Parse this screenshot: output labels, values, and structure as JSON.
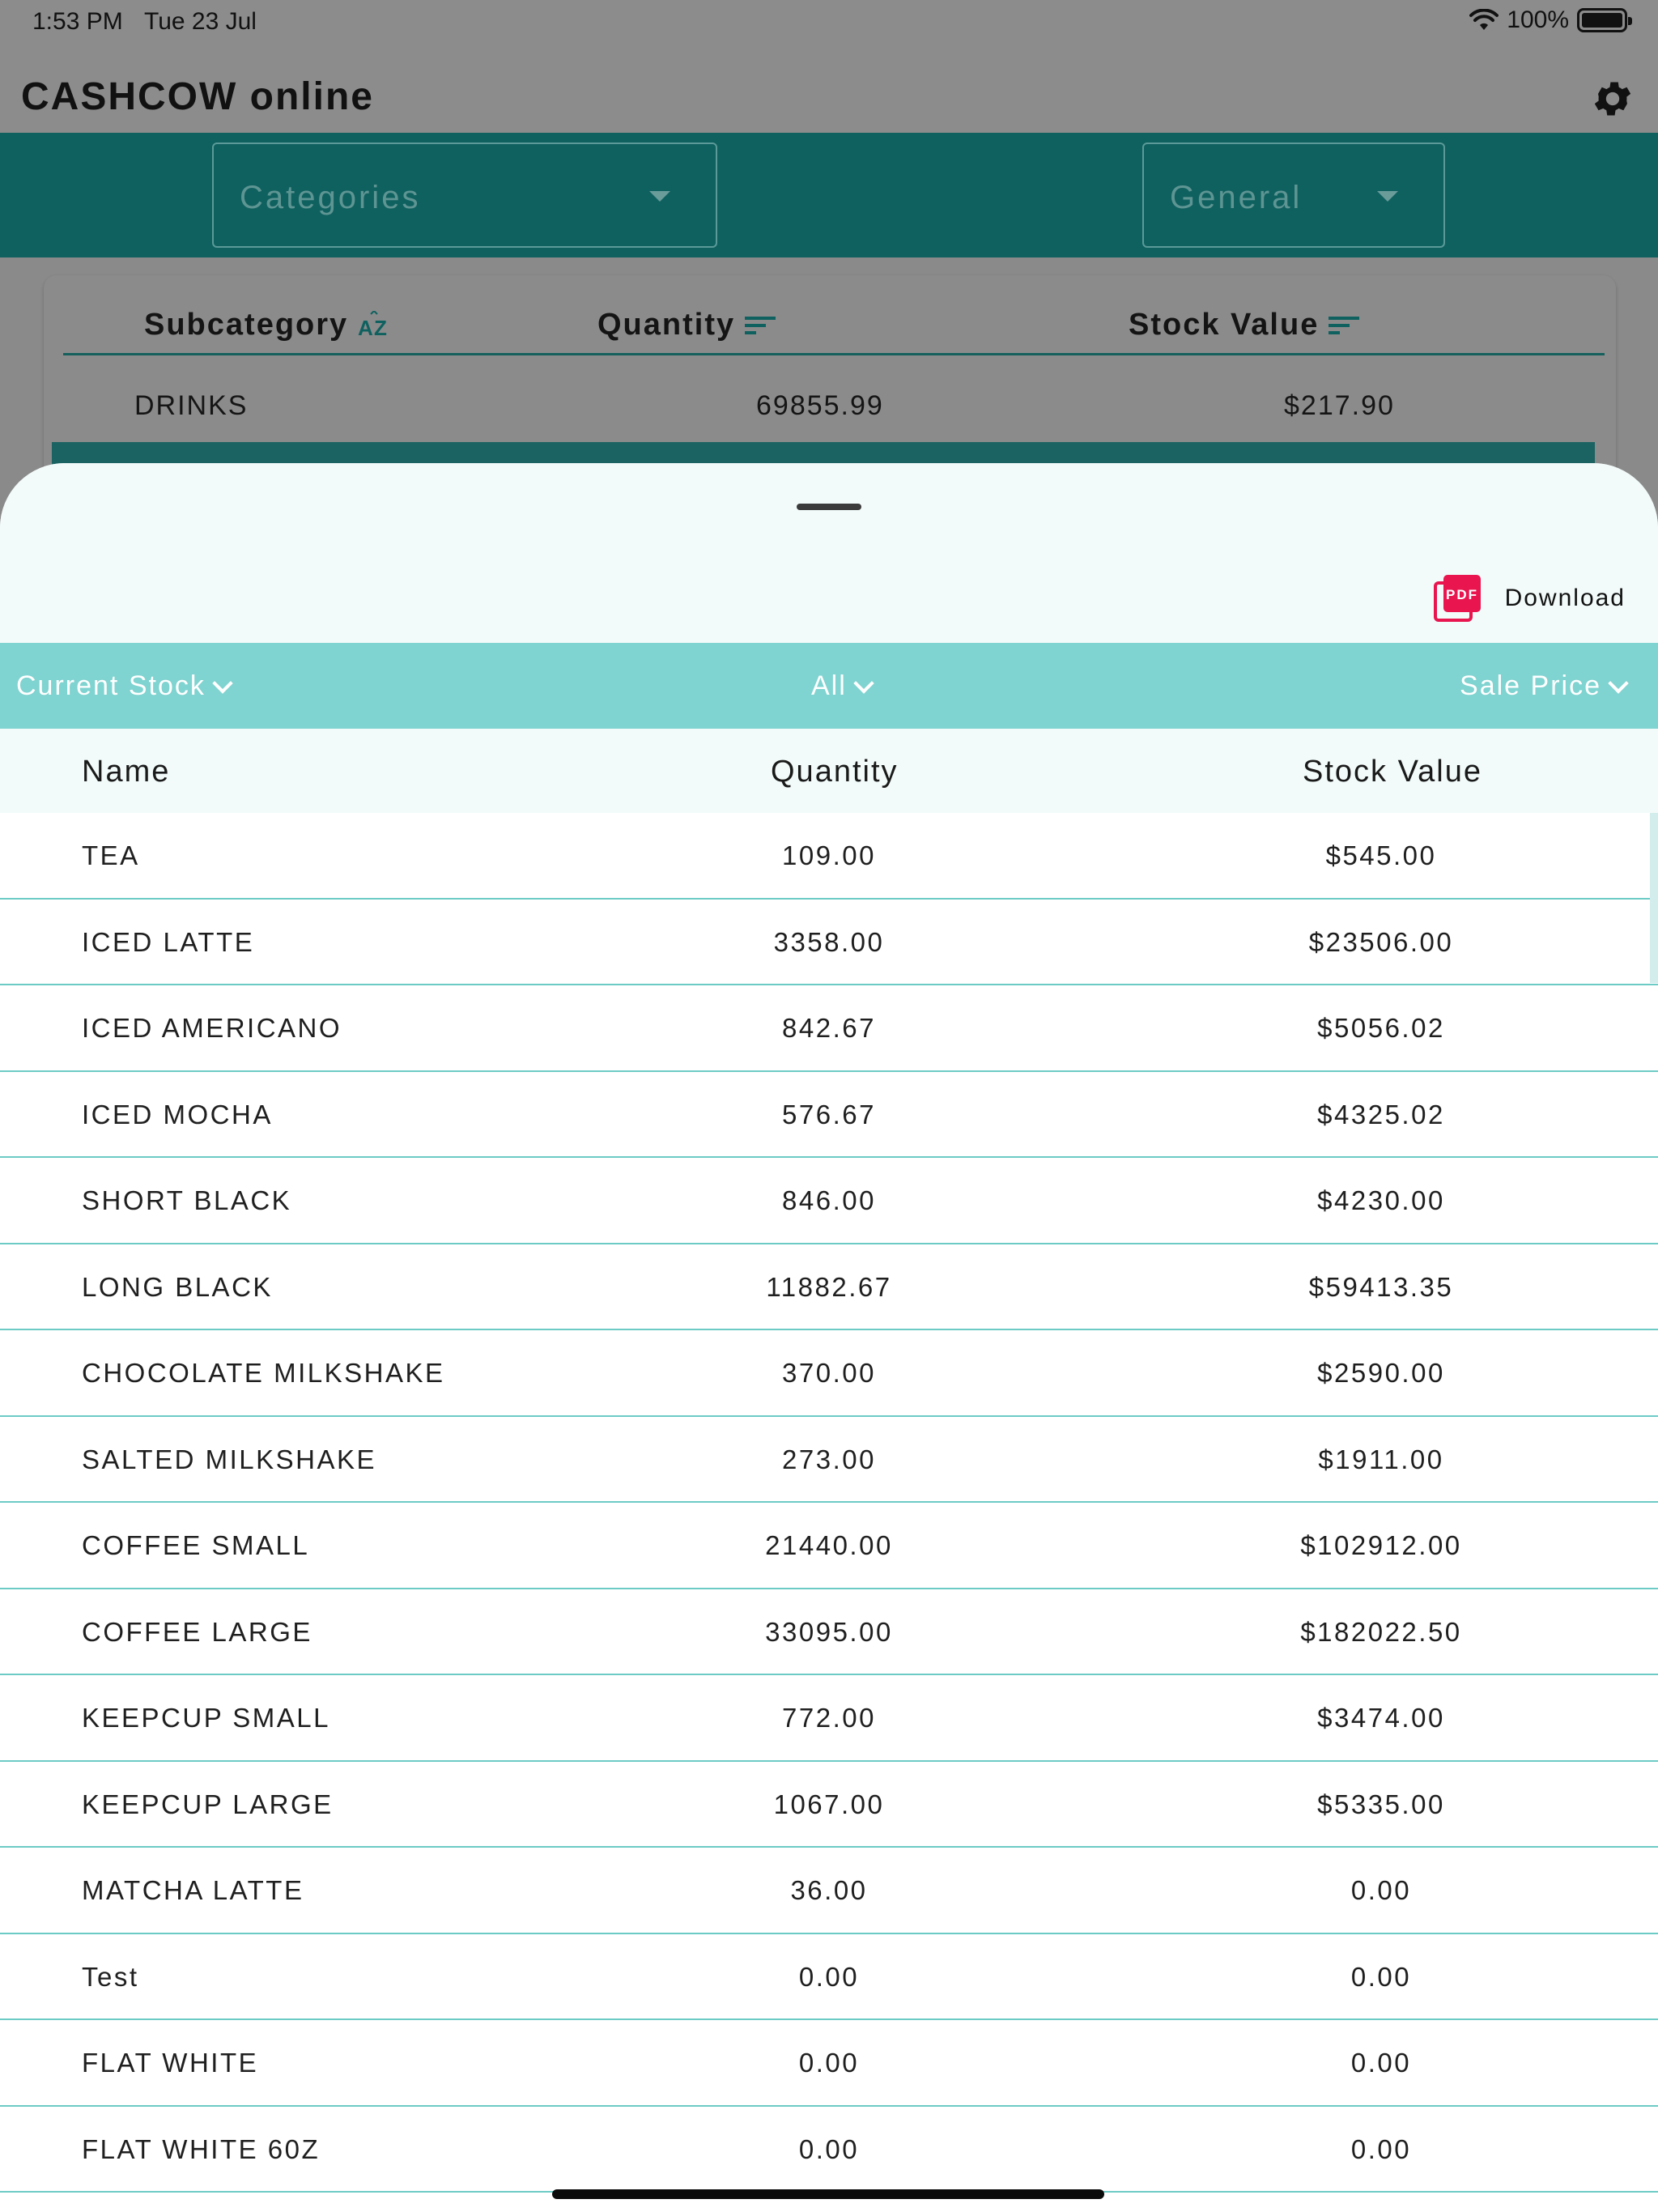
{
  "status_bar": {
    "time": "1:53 PM",
    "date": "Tue 23 Jul",
    "battery": "100%"
  },
  "app": {
    "title": "CASHCOW online"
  },
  "filters": {
    "categories": "Categories",
    "general": "General"
  },
  "summary": {
    "headers": {
      "subcategory": "Subcategory",
      "quantity": "Quantity",
      "stock_value": "Stock Value"
    },
    "row": {
      "name": "DRINKS",
      "quantity": "69855.99",
      "stock_value": "$217.90"
    }
  },
  "sheet": {
    "download_label": "Download",
    "filter_bar": {
      "stock": "Current Stock",
      "scope": "All",
      "price": "Sale Price"
    },
    "columns": {
      "name": "Name",
      "quantity": "Quantity",
      "stock_value": "Stock Value"
    },
    "rows": [
      {
        "name": "TEA",
        "quantity": "109.00",
        "stock_value": "$545.00"
      },
      {
        "name": "ICED LATTE",
        "quantity": "3358.00",
        "stock_value": "$23506.00"
      },
      {
        "name": "ICED AMERICANO",
        "quantity": "842.67",
        "stock_value": "$5056.02"
      },
      {
        "name": "ICED MOCHA",
        "quantity": "576.67",
        "stock_value": "$4325.02"
      },
      {
        "name": "SHORT BLACK",
        "quantity": "846.00",
        "stock_value": "$4230.00"
      },
      {
        "name": "LONG BLACK",
        "quantity": "11882.67",
        "stock_value": "$59413.35"
      },
      {
        "name": "CHOCOLATE MILKSHAKE",
        "quantity": "370.00",
        "stock_value": "$2590.00"
      },
      {
        "name": "SALTED MILKSHAKE",
        "quantity": "273.00",
        "stock_value": "$1911.00"
      },
      {
        "name": "COFFEE SMALL",
        "quantity": "21440.00",
        "stock_value": "$102912.00"
      },
      {
        "name": "COFFEE LARGE",
        "quantity": "33095.00",
        "stock_value": "$182022.50"
      },
      {
        "name": "KEEPCUP SMALL",
        "quantity": "772.00",
        "stock_value": "$3474.00"
      },
      {
        "name": "KEEPCUP LARGE",
        "quantity": "1067.00",
        "stock_value": "$5335.00"
      },
      {
        "name": "MATCHA LATTE",
        "quantity": "36.00",
        "stock_value": "0.00"
      },
      {
        "name": "Test",
        "quantity": "0.00",
        "stock_value": "0.00"
      },
      {
        "name": "FLAT WHITE",
        "quantity": "0.00",
        "stock_value": "0.00"
      },
      {
        "name": "FLAT WHITE 60Z",
        "quantity": "0.00",
        "stock_value": "0.00"
      }
    ]
  },
  "colors": {
    "teal_dark": "#0f6160",
    "teal_light": "#7fd3d0",
    "row_divider": "#6dcbc6",
    "sheet_tint": "#f2fbfa",
    "pdf_red": "#e8154f"
  },
  "icons": {
    "settings": "gear-icon",
    "download": "pdf-icon",
    "sort_alpha": "sort-az-icon",
    "sort": "sort-lines-icon",
    "dropdown": "chevron-down-icon",
    "wifi": "wifi-icon",
    "battery": "battery-icon"
  }
}
